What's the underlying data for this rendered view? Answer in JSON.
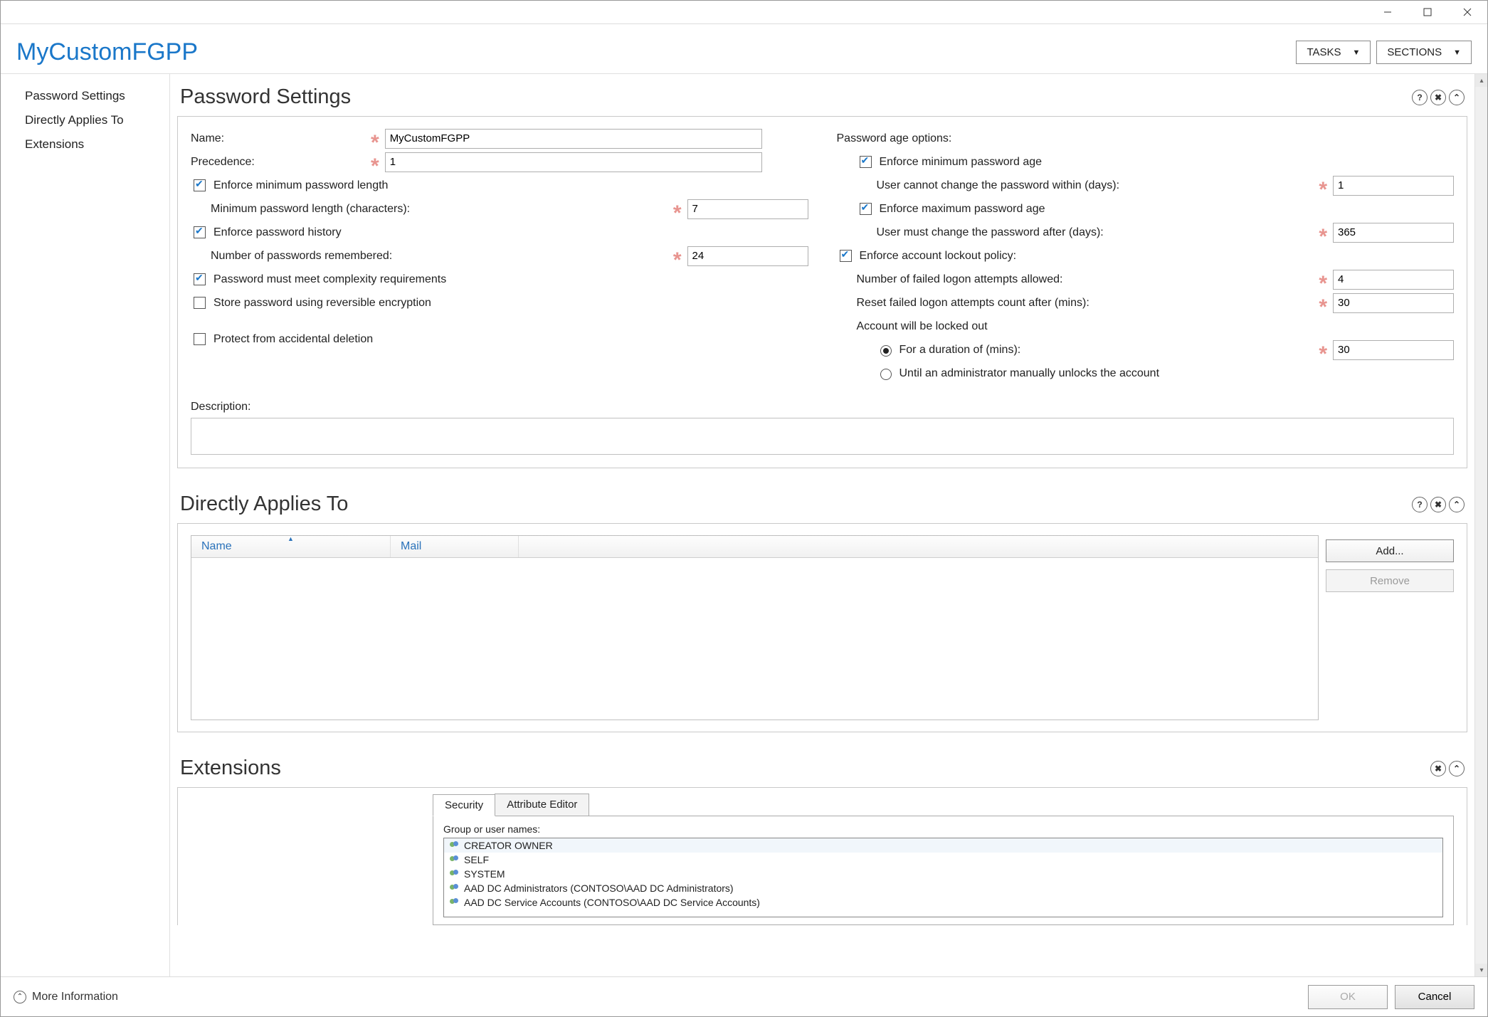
{
  "window_controls": {
    "min": "—",
    "max": "☐",
    "close": "✕"
  },
  "header": {
    "title": "MyCustomFGPP",
    "tasks_btn": "TASKS",
    "sections_btn": "SECTIONS"
  },
  "sidebar": {
    "items": [
      "Password Settings",
      "Directly Applies To",
      "Extensions"
    ]
  },
  "password_settings": {
    "title": "Password Settings",
    "name_label": "Name:",
    "name_value": "MyCustomFGPP",
    "precedence_label": "Precedence:",
    "precedence_value": "1",
    "enforce_min_len_label": "Enforce minimum password length",
    "min_len_label": "Minimum password length (characters):",
    "min_len_value": "7",
    "enforce_history_label": "Enforce password history",
    "history_label": "Number of passwords remembered:",
    "history_value": "24",
    "complexity_label": "Password must meet complexity requirements",
    "reversible_label": "Store password using reversible encryption",
    "protect_label": "Protect from accidental deletion",
    "description_label": "Description:",
    "age_options_label": "Password age options:",
    "enforce_min_age_label": "Enforce minimum password age",
    "min_age_sub": "User cannot change the password within (days):",
    "min_age_value": "1",
    "enforce_max_age_label": "Enforce maximum password age",
    "max_age_sub": "User must change the password after (days):",
    "max_age_value": "365",
    "lockout_label": "Enforce account lockout policy:",
    "failed_attempts_label": "Number of failed logon attempts allowed:",
    "failed_attempts_value": "4",
    "reset_count_label": "Reset failed logon attempts count after (mins):",
    "reset_count_value": "30",
    "account_locked_label": "Account will be locked out",
    "duration_label": "For a duration of (mins):",
    "duration_value": "30",
    "until_admin_label": "Until an administrator manually unlocks the account"
  },
  "applies_to": {
    "title": "Directly Applies To",
    "col_name": "Name",
    "col_mail": "Mail",
    "add_btn": "Add...",
    "remove_btn": "Remove"
  },
  "extensions": {
    "title": "Extensions",
    "tab_security": "Security",
    "tab_attr": "Attribute Editor",
    "group_label": "Group or user names:",
    "principals": [
      "CREATOR OWNER",
      "SELF",
      "SYSTEM",
      "AAD DC Administrators (CONTOSO\\AAD DC Administrators)",
      "AAD DC Service Accounts (CONTOSO\\AAD DC Service Accounts)"
    ]
  },
  "footer": {
    "more_info": "More Information",
    "ok": "OK",
    "cancel": "Cancel"
  },
  "icons": {
    "help": "?",
    "close": "✖",
    "collapse": "⌃"
  }
}
